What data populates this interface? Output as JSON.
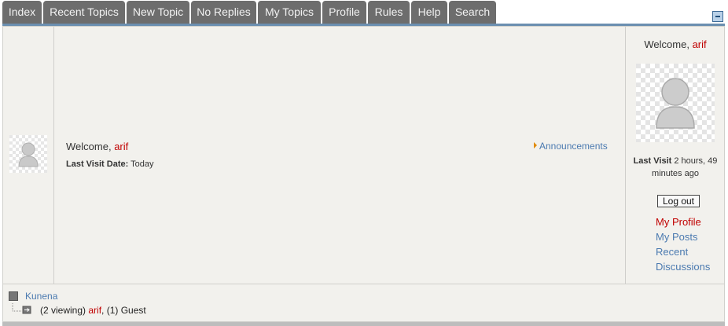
{
  "tabs": [
    {
      "label": "Index"
    },
    {
      "label": "Recent Topics"
    },
    {
      "label": "New Topic"
    },
    {
      "label": "No Replies"
    },
    {
      "label": "My Topics"
    },
    {
      "label": "Profile"
    },
    {
      "label": "Rules"
    },
    {
      "label": "Help"
    },
    {
      "label": "Search"
    }
  ],
  "main": {
    "welcome_prefix": "Welcome,",
    "username": "arif",
    "last_visit_label": "Last Visit Date:",
    "last_visit_value": "Today",
    "announcements": "Announcements"
  },
  "right": {
    "welcome_prefix": "Welcome,",
    "username": "arif",
    "last_visit_label": "Last Visit",
    "last_visit_value": "2 hours, 49 minutes ago",
    "logout": "Log out",
    "my_profile": "My Profile",
    "my_posts": "My Posts",
    "recent_discussions": "Recent Discussions"
  },
  "bottom": {
    "category": "Kunena",
    "viewing_prefix": "(2 viewing)",
    "viewing_user": "arif",
    "viewing_suffix": ", (1) Guest"
  },
  "colors": {
    "tab_bg": "#6d6d6d",
    "link_blue": "#4b7ab0",
    "user_red": "#c00000",
    "panel_bg": "#f2f1ed"
  }
}
